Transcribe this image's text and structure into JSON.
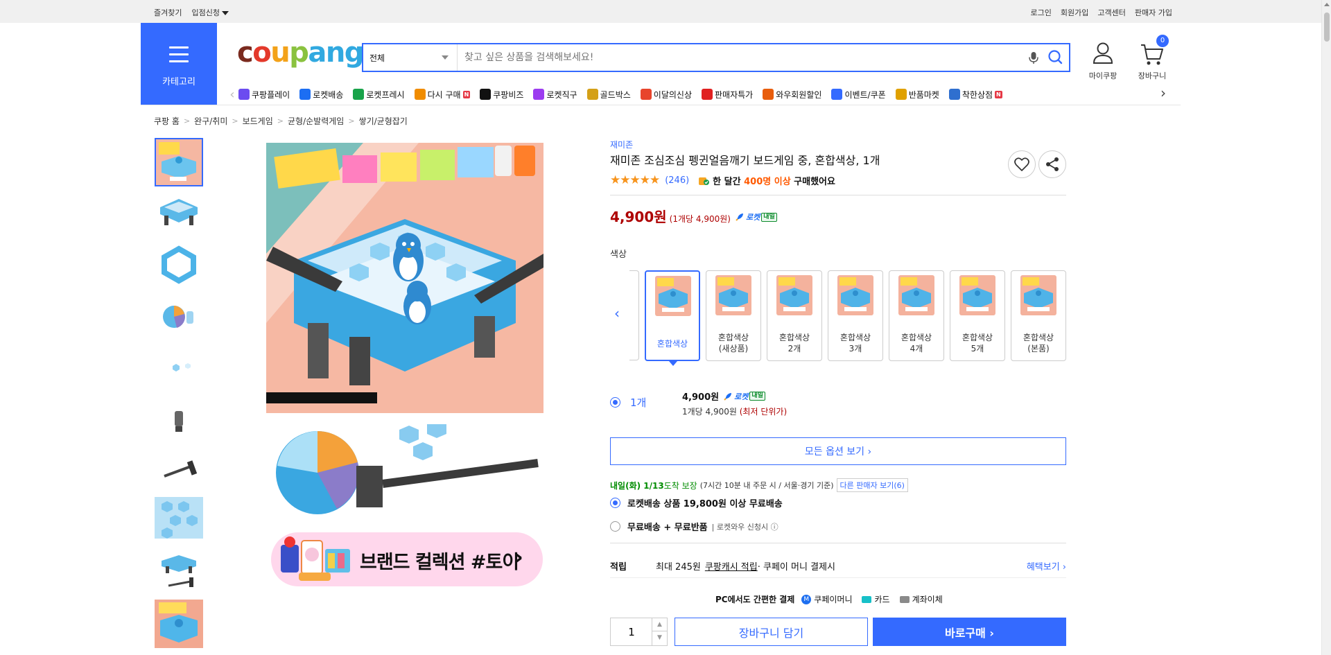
{
  "topbar": {
    "favorites": "즐겨찾기",
    "seller_apply": "입점신청",
    "login": "로그인",
    "signup": "회원가입",
    "customer_center": "고객센터",
    "seller_signup": "판매자 가입"
  },
  "header": {
    "category_label": "카테고리",
    "logo_parts": [
      "c",
      "o",
      "u",
      "p",
      "ang"
    ],
    "search_category": "전체",
    "search_placeholder": "찾고 싶은 상품을 검색해보세요!",
    "my_coupang": "마이쿠팡",
    "cart": "장바구니",
    "cart_count": "0"
  },
  "nav": {
    "items": [
      {
        "label": "쿠팡플레이",
        "icon": "play-icon",
        "color": "#6b4cf0",
        "badge": ""
      },
      {
        "label": "로켓배송",
        "icon": "rocket-icon",
        "color": "#1c6ef3",
        "badge": ""
      },
      {
        "label": "로켓프레시",
        "icon": "rocket-fresh-icon",
        "color": "#19a34a",
        "badge": ""
      },
      {
        "label": "다시 구매",
        "icon": "rebuy-icon",
        "color": "#f08c00",
        "badge": "N"
      },
      {
        "label": "쿠팡비즈",
        "icon": "biz-icon",
        "color": "#111111",
        "badge": ""
      },
      {
        "label": "로켓직구",
        "icon": "global-icon",
        "color": "#9c3cf0",
        "badge": ""
      },
      {
        "label": "골드박스",
        "icon": "goldbox-icon",
        "color": "#d4a017",
        "badge": ""
      },
      {
        "label": "이달의신상",
        "icon": "new-icon",
        "color": "#e8452c",
        "badge": ""
      },
      {
        "label": "판매자특가",
        "icon": "seller-deal-icon",
        "color": "#e02020",
        "badge": ""
      },
      {
        "label": "와우회원할인",
        "icon": "wow-icon",
        "color": "#e85d0c",
        "badge": ""
      },
      {
        "label": "이벤트/쿠폰",
        "icon": "coupon-icon",
        "color": "#346aff",
        "badge": ""
      },
      {
        "label": "반품마켓",
        "icon": "return-market-icon",
        "color": "#e0a100",
        "badge": ""
      },
      {
        "label": "착한상점",
        "icon": "good-store-icon",
        "color": "#2f6fcf",
        "badge": "N"
      }
    ]
  },
  "breadcrumb": [
    "쿠팡 홈",
    "완구/취미",
    "보드게임",
    "균형/순발력게임",
    "쌓기/균형잡기"
  ],
  "banner": {
    "text": "브랜드 컬렉션 #토이"
  },
  "product": {
    "brand": "재미존",
    "title": "재미존 조심조심 펭귄얼음깨기 보드게임 중, 혼합색상, 1개",
    "rating": 4.5,
    "stars_text": "★★★★★",
    "review_count": "(246)",
    "bought_prefix": "한 달간 ",
    "bought_highlight": "400명 이상",
    "bought_suffix": " 구매했어요",
    "price": "4,900원",
    "unit_price": "(1개당 4,900원)",
    "rocket_label": "로켓",
    "rocket_day": "내일",
    "option_label": "색상",
    "options": [
      {
        "label": "혼합색상",
        "selected": true
      },
      {
        "label": "혼합색상\n(새상품)",
        "selected": false
      },
      {
        "label": "혼합색상\n2개",
        "selected": false
      },
      {
        "label": "혼합색상\n3개",
        "selected": false
      },
      {
        "label": "혼합색상\n4개",
        "selected": false
      },
      {
        "label": "혼합색상\n5개",
        "selected": false
      },
      {
        "label": "혼합색상\n(본품)",
        "selected": false
      }
    ],
    "qty_option": "1개",
    "qty_price": "4,900원",
    "qty_unit_prefix": "1개당 4,900원 ",
    "qty_unit_note": "(최저 단위가)",
    "all_options": "모든 옵션 보기 ›",
    "delivery_date": "내일(화) 1/13",
    "delivery_guarantee": " 도착 보장",
    "delivery_note": "(7시간 10분 내 주문 시 / 서울·경기 기준)",
    "other_sellers": "다른 판매자 보기(6)",
    "ship1": "로켓배송 상품 19,800원 이상 무료배송",
    "ship2": "무료배송 + 무료반품",
    "ship2_note": "| 로켓와우 신청시 ⓘ",
    "reward_label": "적립",
    "reward_text": "최대 245원",
    "reward_link": "쿠팡캐시 적립",
    "reward_suffix": " · 쿠페이 머니 결제시",
    "benefit_more": "혜택보기 ›",
    "pay_pc": "PC에서도 간편한 결제",
    "pay_money": "쿠페이머니",
    "pay_card": "카드",
    "pay_bank": "계좌이체",
    "quantity": "1",
    "add_cart": "장바구니 담기",
    "buy_now": "바로구매 ›"
  }
}
